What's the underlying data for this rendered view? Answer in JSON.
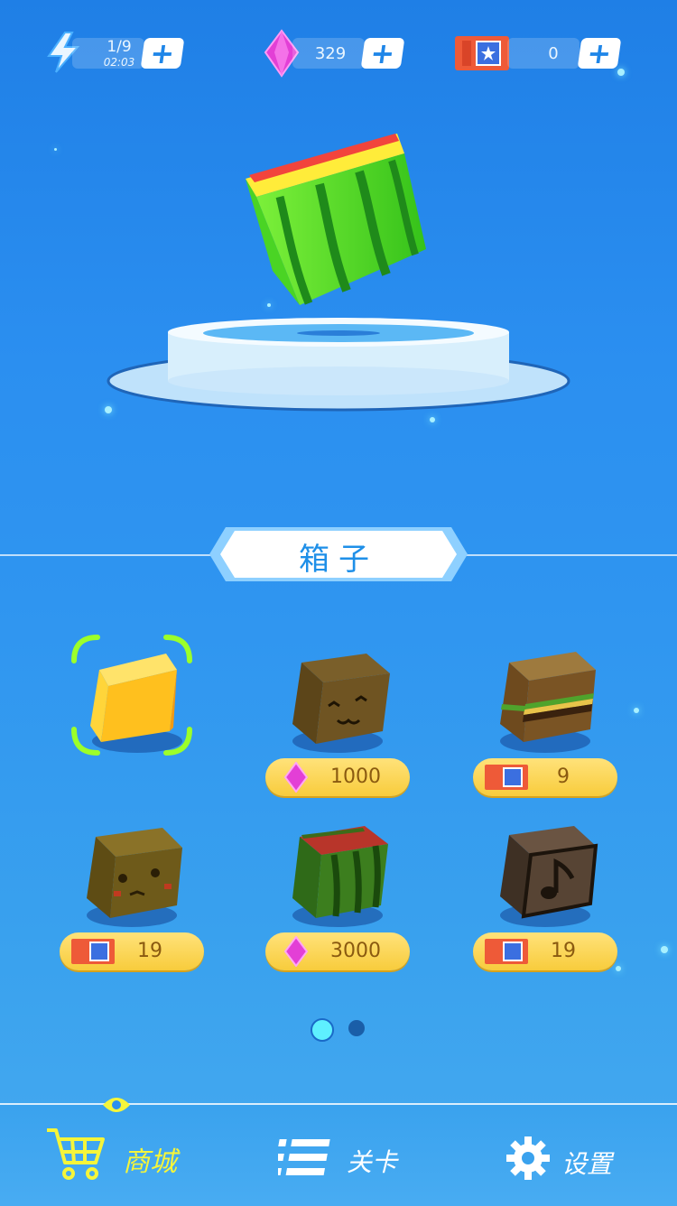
{
  "topbar": {
    "energy": {
      "value": "1/9",
      "timer": "02:03"
    },
    "gems": {
      "value": "329"
    },
    "coupons": {
      "value": "0"
    }
  },
  "section": {
    "title": "箱子"
  },
  "items": [
    {
      "name": "yellow-cube",
      "selected": true,
      "price": null
    },
    {
      "name": "cat-cube",
      "currency": "gem",
      "price": "1000"
    },
    {
      "name": "burger-cube",
      "currency": "coupon",
      "price": "9"
    },
    {
      "name": "face-cube",
      "currency": "coupon",
      "price": "19"
    },
    {
      "name": "watermelon-cube",
      "currency": "gem",
      "price": "3000"
    },
    {
      "name": "music-cube",
      "currency": "coupon",
      "price": "19"
    }
  ],
  "pager": {
    "current": 1,
    "total": 2
  },
  "nav": {
    "shop": "商城",
    "levels": "关卡",
    "settings": "设置"
  },
  "colors": {
    "accent_active": "#f5f53a",
    "gem": "#e040d8",
    "price_pill": "#f8cc3c"
  }
}
